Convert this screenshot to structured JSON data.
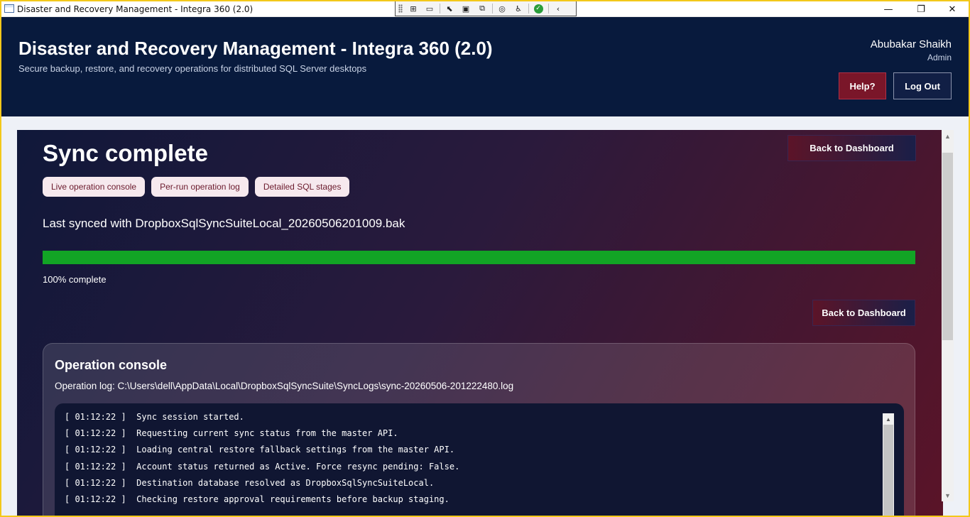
{
  "window": {
    "title": "Disaster and Recovery Management - Integra 360 (2.0)",
    "minimize_glyph": "—",
    "maximize_glyph": "❐",
    "close_glyph": "✕"
  },
  "header": {
    "title": "Disaster and Recovery Management - Integra 360 (2.0)",
    "subtitle": "Secure backup, restore, and recovery operations for distributed SQL Server desktops",
    "user_name": "Abubakar Shaikh",
    "user_role": "Admin",
    "help_label": "Help?",
    "logout_label": "Log Out"
  },
  "main": {
    "title": "Sync complete",
    "back_label_top": "Back to Dashboard",
    "back_label_mid": "Back to Dashboard",
    "chips": [
      "Live operation console",
      "Per-run operation log",
      "Detailed SQL stages"
    ],
    "last_synced": "Last synced with DropboxSqlSyncSuiteLocal_20260506201009.bak",
    "progress_percent": 100,
    "progress_text": "100% complete"
  },
  "console": {
    "title": "Operation console",
    "log_path": "Operation log: C:\\Users\\dell\\AppData\\Local\\DropboxSqlSyncSuite\\SyncLogs\\sync-20260506-201222480.log",
    "lines": [
      "[ 01:12:22 ]  Sync session started.",
      "[ 01:12:22 ]  Requesting current sync status from the master API.",
      "[ 01:12:22 ]  Loading central restore fallback settings from the master API.",
      "[ 01:12:22 ]  Account status returned as Active. Force resync pending: False.",
      "[ 01:12:22 ]  Destination database resolved as DropboxSqlSyncSuiteLocal.",
      "[ 01:12:22 ]  Checking restore approval requirements before backup staging."
    ]
  },
  "colors": {
    "header_bg": "#081a3d",
    "progress_fill": "#12a425",
    "accent_red": "#7a1629",
    "chip_bg": "#f6e9ee"
  }
}
